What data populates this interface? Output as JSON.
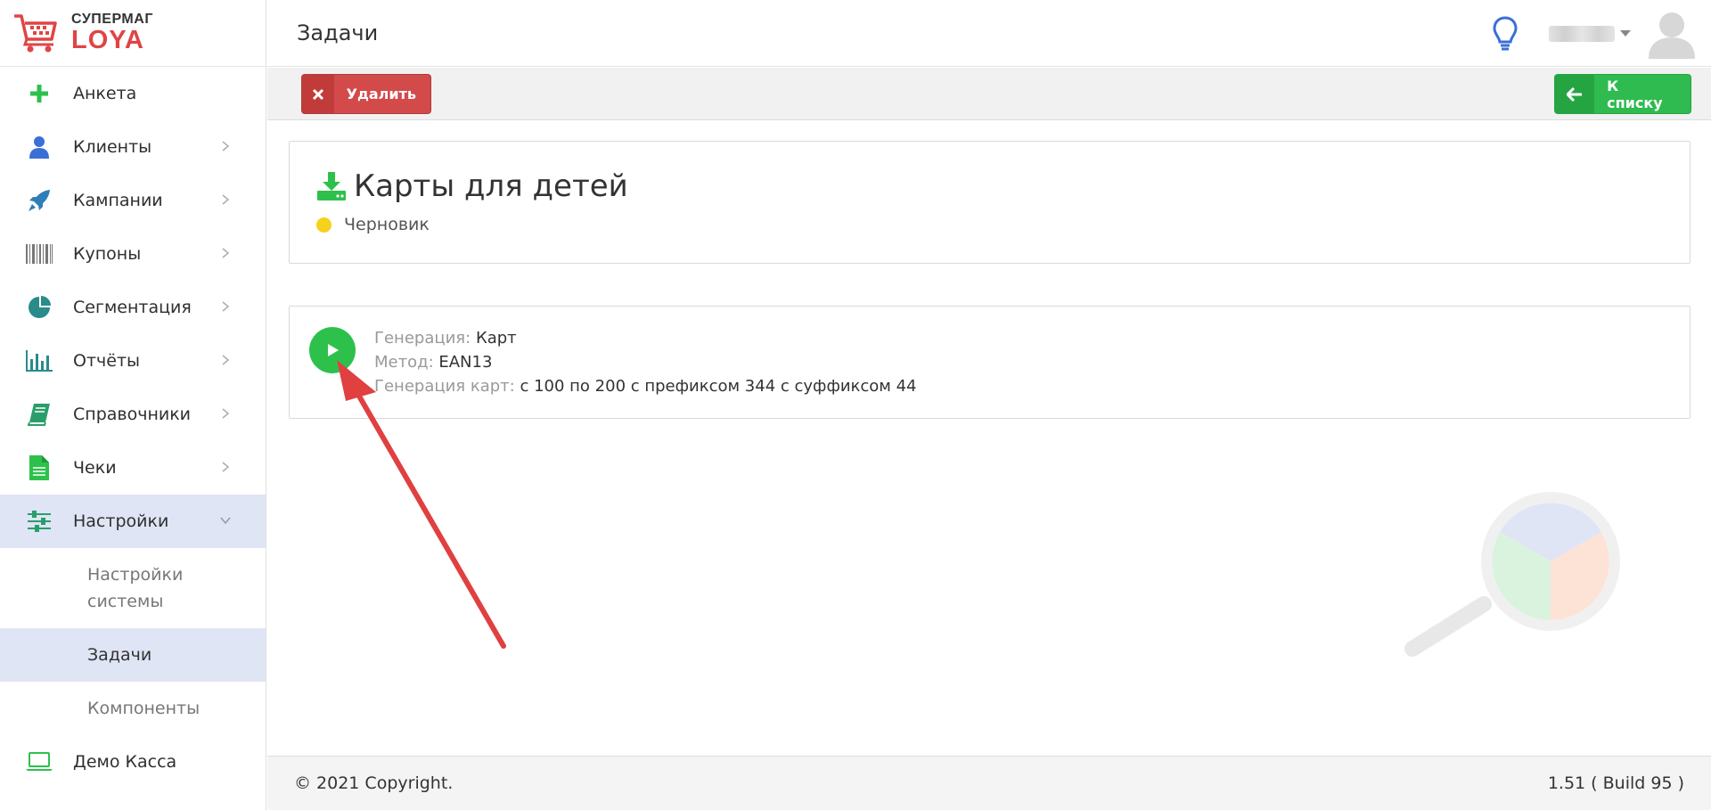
{
  "brand": {
    "name_top": "СУПЕРМАГ",
    "name_bottom": "LOYA",
    "accent": "#e04444"
  },
  "sidebar": {
    "items": [
      {
        "label": "Анкета",
        "icon": "plus-icon"
      },
      {
        "label": "Клиенты",
        "icon": "user-icon"
      },
      {
        "label": "Кампании",
        "icon": "rocket-icon"
      },
      {
        "label": "Купоны",
        "icon": "barcode-icon"
      },
      {
        "label": "Сегментация",
        "icon": "pie-chart-icon"
      },
      {
        "label": "Отчёты",
        "icon": "bar-chart-icon"
      },
      {
        "label": "Справочники",
        "icon": "book-icon"
      },
      {
        "label": "Чеки",
        "icon": "document-icon"
      },
      {
        "label": "Настройки",
        "icon": "sliders-icon"
      },
      {
        "label": "Демо Касса",
        "icon": "laptop-icon"
      }
    ],
    "subitems": [
      "Настройки системы",
      "Задачи",
      "Компоненты"
    ]
  },
  "header": {
    "title": "Задачи"
  },
  "toolbar": {
    "delete_label": "Удалить",
    "back_label": "К списку"
  },
  "task": {
    "title": "Карты для детей",
    "status": "Черновик",
    "status_color": "#f5d21b"
  },
  "details": [
    {
      "key": "Генерация",
      "value": "Карт"
    },
    {
      "key": "Метод",
      "value": "EAN13"
    },
    {
      "key": "Генерация карт",
      "value": "с 100 по 200 с префиксом 344 с суффиксом 44"
    }
  ],
  "footer": {
    "copyright": "© 2021 Copyright.",
    "version": "1.51 ( Build 95 )"
  },
  "colors": {
    "green": "#2dc14c",
    "red": "#d34a4a",
    "active_bg": "#dfe5f4"
  }
}
